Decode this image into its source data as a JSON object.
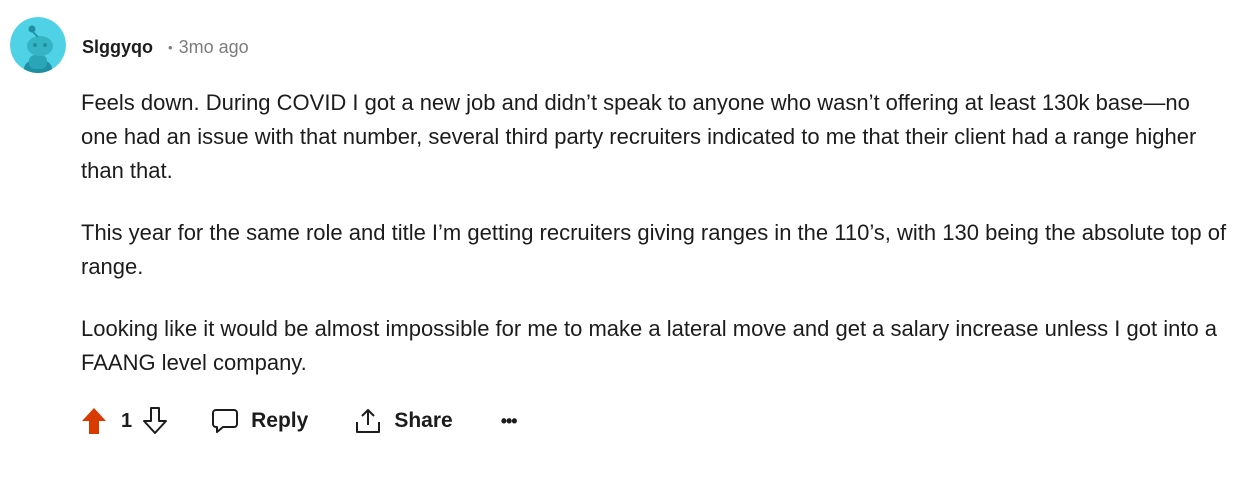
{
  "comment": {
    "author": "Slggyqo",
    "separator": "•",
    "age": "3mo ago",
    "paragraphs": [
      "Feels down. During COVID I got a new job and didn’t speak to anyone who wasn’t offering at least 130k base—no one had an issue with that number, several third party recruiters indicated to me that their client had a range higher than that.",
      "This year for the same role and title I’m getting recruiters giving ranges in the 110’s, with 130 being the absolute top of range.",
      "Looking like it would be almost impossible for me to make a lateral move and get a salary increase unless I got into a FAANG level company."
    ],
    "avatar_icon": "reddit-snoo-avatar"
  },
  "actions": {
    "upvote_icon": "upvote-arrow-icon",
    "vote_count": "1",
    "downvote_icon": "downvote-arrow-icon",
    "reply_label": "Reply",
    "reply_icon": "speech-bubble-icon",
    "share_label": "Share",
    "share_icon": "share-arrow-icon",
    "more_label": "•••"
  },
  "colors": {
    "upvote_active": "#d93a00",
    "avatar_bg": "#46d1e8",
    "text": "#1c1c1c",
    "muted": "#7c7c7c"
  }
}
